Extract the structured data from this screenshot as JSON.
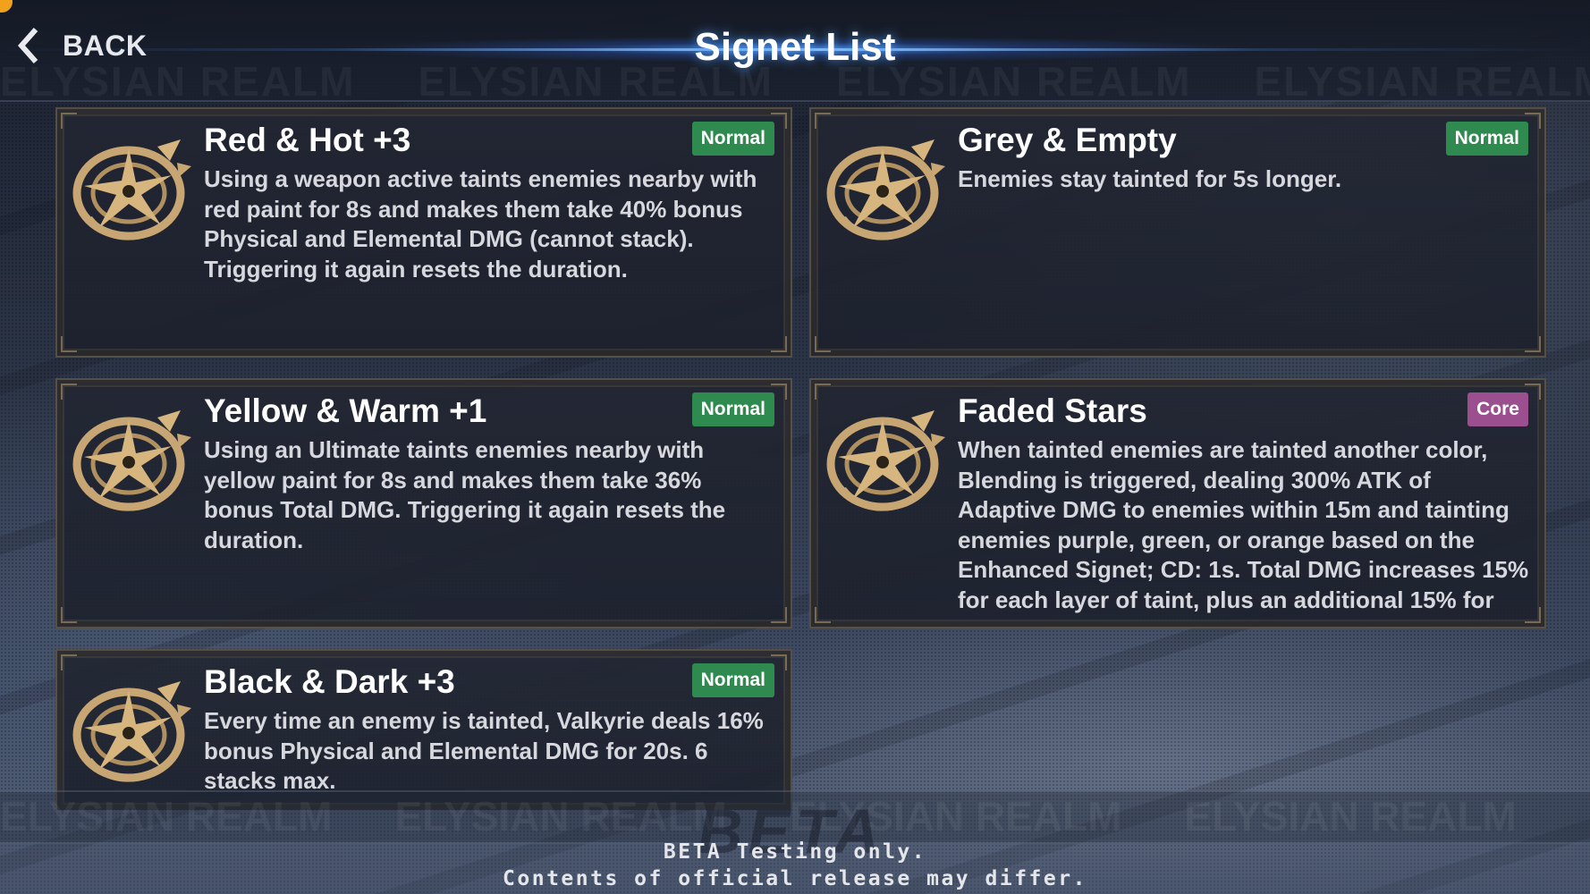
{
  "header": {
    "back_label": "BACK",
    "title": "Signet List",
    "banner_text": "ELYSIAN REALM"
  },
  "signets": [
    {
      "title": "Red & Hot +3",
      "tier": "Normal",
      "description": "Using a weapon active taints enemies nearby with red paint for 8s and makes them take 40% bonus Physical and Elemental DMG (cannot stack). Triggering it again resets the duration.",
      "icon": "signet-emblem-icon"
    },
    {
      "title": "Grey & Empty",
      "tier": "Normal",
      "description": "Enemies stay tainted for 5s longer.",
      "icon": "signet-emblem-icon"
    },
    {
      "title": "Yellow & Warm +1",
      "tier": "Normal",
      "description": "Using an Ultimate taints enemies nearby with yellow paint for 8s and makes them take 36% bonus Total DMG. Triggering it again resets the duration.",
      "icon": "signet-emblem-icon"
    },
    {
      "title": "Faded Stars",
      "tier": "Core",
      "description": "When tainted enemies are tainted another color, Blending is triggered, dealing 300% ATK of Adaptive DMG to enemies within 15m and tainting enemies purple, green, or orange based on the Enhanced Signet; CD: 1s. Total DMG increases 15% for each layer of taint, plus an additional 15% for",
      "icon": "signet-emblem-icon"
    },
    {
      "title": "Black & Dark +3",
      "tier": "Normal",
      "description": "Every time an enemy is tainted, Valkyrie deals 16% bonus Physical and Elemental DMG for 20s. 6 stacks max.",
      "icon": "signet-emblem-icon"
    }
  ],
  "footer": {
    "watermark": "BETA",
    "notice_line1": "BETA Testing only.",
    "notice_line2": "Contents of official release may differ."
  },
  "colors": {
    "normal_badge": "#2f8a4f",
    "core_badge": "#9c4f8f",
    "header_glow": "#4696ff"
  }
}
